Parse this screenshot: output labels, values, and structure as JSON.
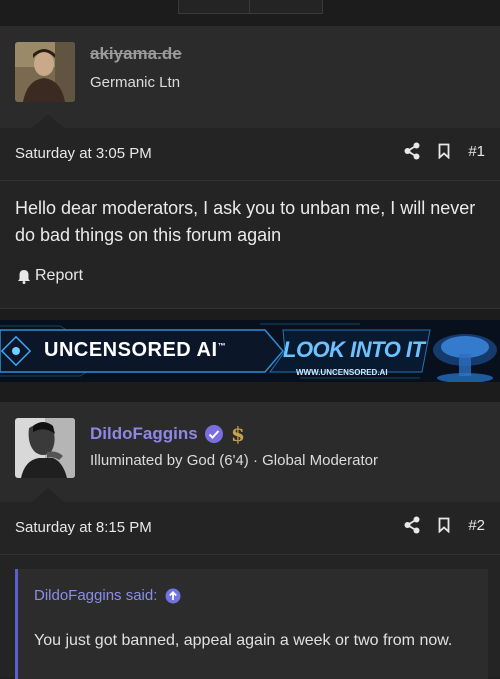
{
  "posts": [
    {
      "username": "akiyama.de",
      "user_title": "Germanic Ltn",
      "date": "Saturday at 3:05 PM",
      "post_number": "#1",
      "body": "Hello dear moderators, I ask you to unban me, I will never do bad things on this forum again",
      "report_label": "Report"
    },
    {
      "username": "DildoFaggins",
      "user_title": "Illuminated by God (6'4) · Global Moderator",
      "date": "Saturday at 8:15 PM",
      "post_number": "#2",
      "quote_author": "DildoFaggins said:",
      "quote_text": "You just got banned, appeal again a week or two from now."
    }
  ],
  "banner": {
    "left_text": "UNCENSORED AI",
    "tm": "™",
    "right_text": "LOOK INTO IT",
    "url": "WWW.UNCENSORED.AI"
  },
  "colors": {
    "accent": "#5b5fc7",
    "username_purple": "#8e87e6",
    "badge_gold": "#c9a24a"
  },
  "icons": [
    "share-icon",
    "bookmark-icon",
    "bell-icon",
    "verified-icon",
    "dollar-icon",
    "arrow-up-circle-icon"
  ]
}
